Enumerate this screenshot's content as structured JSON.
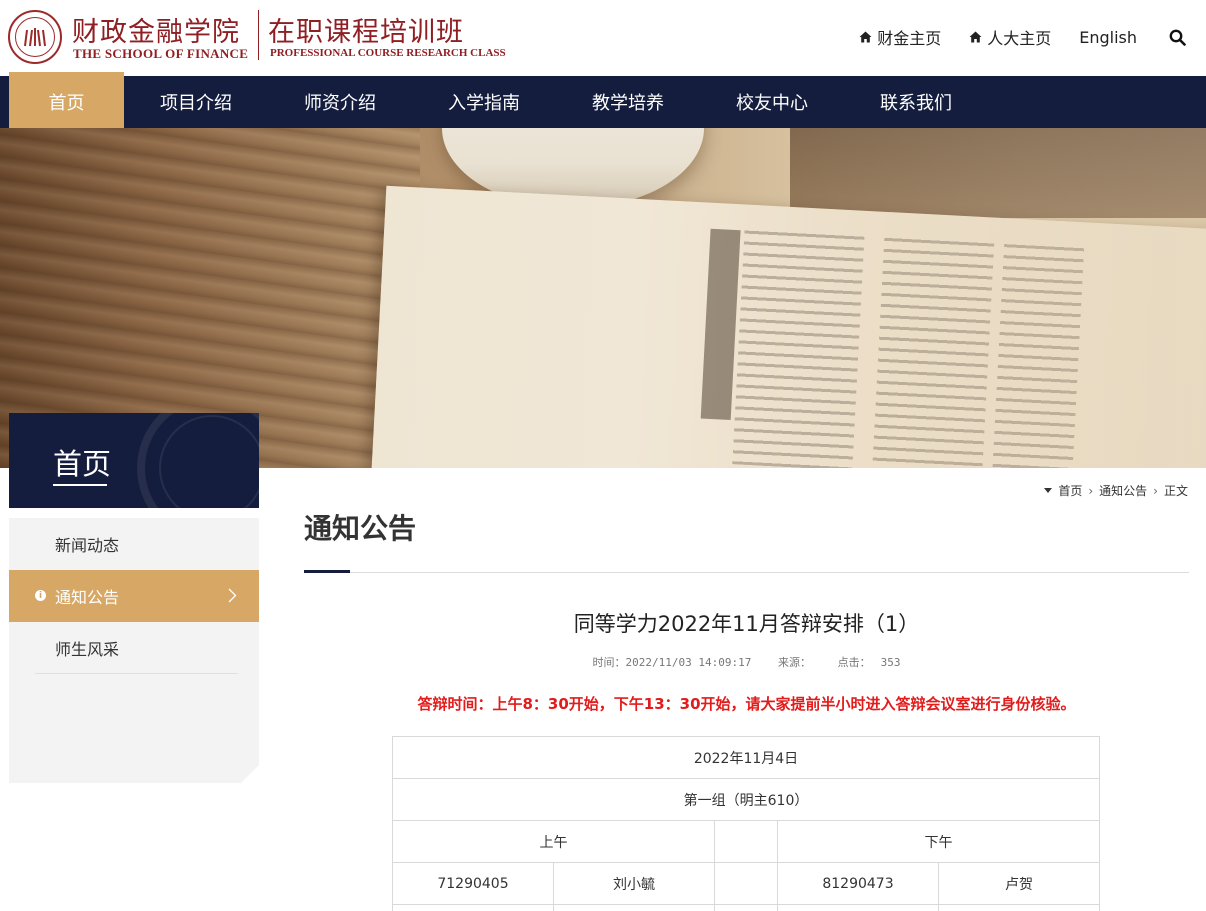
{
  "header": {
    "logo_cn": "财政金融学院",
    "logo_en": "THE SCHOOL OF FINANCE",
    "program_cn": "在职课程培训班",
    "program_en": "PROFESSIONAL COURSE RESEARCH CLASS",
    "links": {
      "finance_home": "财金主页",
      "ruc_home": "人大主页",
      "english": "English"
    },
    "icons": {
      "home": "home-icon",
      "search": "search-icon"
    }
  },
  "nav": {
    "items": [
      "首页",
      "项目介绍",
      "师资介绍",
      "入学指南",
      "教学培养",
      "校友中心",
      "联系我们"
    ],
    "active_index": 0
  },
  "sidebar": {
    "title": "首页",
    "items": [
      "新闻动态",
      "通知公告",
      "师生风采"
    ],
    "active_index": 1
  },
  "breadcrumb": {
    "items": [
      "首页",
      "通知公告",
      "正文"
    ]
  },
  "section": {
    "title": "通知公告"
  },
  "article": {
    "title": "同等学力2022年11月答辩安排（1）",
    "meta_time": "时间：2022/11/03 14:09:17",
    "meta_source": "来源：",
    "meta_clicks_label": "点击：",
    "meta_clicks": "353",
    "notice": "答辩时间：上午8：30开始，下午13：30开始，请大家提前半小时进入答辩会议室进行身份核验。"
  },
  "table": {
    "date": "2022年11月4日",
    "group": "第一组（明主610）",
    "am_label": "上午",
    "pm_label": "下午",
    "rows": [
      {
        "am_id": "71290405",
        "am_name": "刘小毓",
        "pm_id": "81290473",
        "pm_name": "卢贺"
      }
    ]
  },
  "colors": {
    "navy": "#141d3d",
    "gold": "#d7a865",
    "brand_red": "#8f1f23",
    "notice_red": "#e31b1b"
  }
}
